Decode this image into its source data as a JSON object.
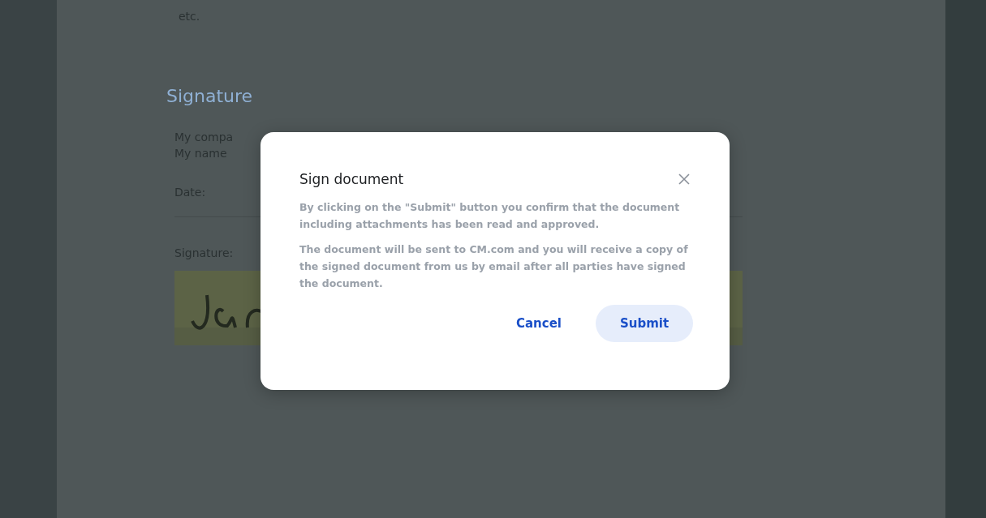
{
  "document": {
    "trailing_text": "etc.",
    "section_title": "Signature",
    "company_label": "My compa",
    "name_label": "My name",
    "date_label": "Date:",
    "signature_label": "Signature:"
  },
  "dialog": {
    "title": "Sign document",
    "paragraphs": [
      "By clicking on the \"Submit\" button you confirm that the document including attachments has been read and approved.",
      "The document will be sent to CM.com and you will receive a copy of the signed document from us by email after all parties have signed the document."
    ],
    "buttons": [
      {
        "label": "Cancel",
        "kind": "text"
      },
      {
        "label": "Submit",
        "kind": "filled"
      }
    ]
  }
}
